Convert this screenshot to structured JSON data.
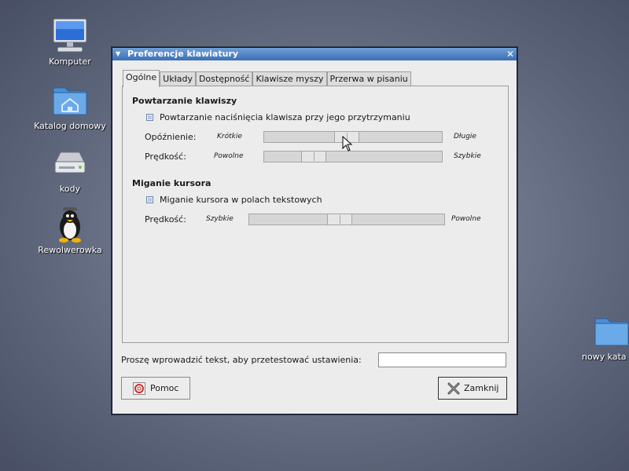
{
  "desktop": {
    "icons": [
      {
        "label": "Komputer"
      },
      {
        "label": "Katalog domowy"
      },
      {
        "label": "kody"
      },
      {
        "label": "Rewolwerowka"
      },
      {
        "label": "nowy kata"
      }
    ]
  },
  "window": {
    "title": "Preferencje klawiatury",
    "tabs": [
      "Ogólne",
      "Układy",
      "Dostępność",
      "Klawisze myszy",
      "Przerwa w pisaniu"
    ],
    "active_tab": "Ogólne"
  },
  "repeat": {
    "section_title": "Powtarzanie klawiszy",
    "checkbox_label": "Powtarzanie naciśnięcia klawisza przy jego przytrzymaniu",
    "checked": true,
    "delay": {
      "label": "Opóźnienie:",
      "min": "Krótkie",
      "max": "Długie",
      "value": 0.46
    },
    "speed": {
      "label": "Prędkość:",
      "min": "Powolne",
      "max": "Szybkie",
      "value": 0.24
    }
  },
  "cursor": {
    "section_title": "Miganie kursora",
    "checkbox_label": "Miganie kursora w polach tekstowych",
    "checked": true,
    "speed": {
      "label": "Prędkość:",
      "min": "Szybkie",
      "max": "Powolne",
      "value": 0.46
    }
  },
  "test": {
    "label": "Proszę wprowadzić tekst, aby przetestować ustawienia:",
    "value": ""
  },
  "buttons": {
    "help": "Pomoc",
    "close": "Zamknij"
  },
  "colors": {
    "titlebar": "#3c6fb5",
    "desktop": "#5c6479"
  }
}
